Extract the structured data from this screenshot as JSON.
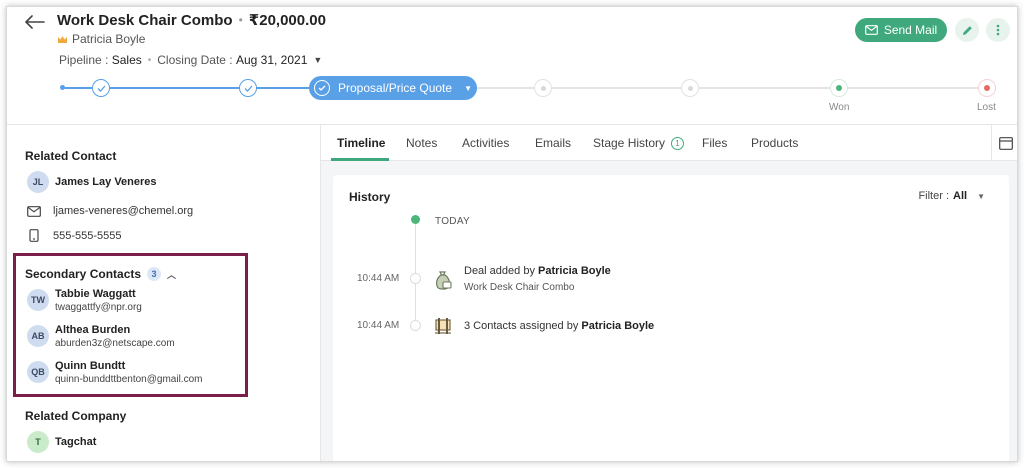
{
  "header": {
    "deal_name": "Work Desk Chair Combo",
    "amount": "₹20,000.00",
    "owner": "Patricia Boyle",
    "pipeline_label": "Pipeline :",
    "pipeline_value": "Sales",
    "closing_label": "Closing Date :",
    "closing_value": "Aug 31, 2021",
    "send_mail_label": "Send Mail"
  },
  "pipeline": {
    "current_stage": "Proposal/Price Quote",
    "won_label": "Won",
    "lost_label": "Lost"
  },
  "left": {
    "related_contact_title": "Related Contact",
    "primary_contact": {
      "initials": "JL",
      "name": "James Lay Veneres"
    },
    "email": "ljames-veneres@chemel.org",
    "phone": "555-555-5555",
    "secondary_title": "Secondary Contacts",
    "secondary_count": "3",
    "secondary_contacts": [
      {
        "initials": "TW",
        "name": "Tabbie Waggatt",
        "email": "twaggattfy@npr.org"
      },
      {
        "initials": "AB",
        "name": "Althea Burden",
        "email": "aburden3z@netscape.com"
      },
      {
        "initials": "QB",
        "name": "Quinn Bundtt",
        "email": "quinn-bunddttbenton@gmail.com"
      }
    ],
    "related_company_title": "Related Company",
    "company": {
      "initials": "T",
      "name": "Tagchat"
    }
  },
  "tabs": [
    {
      "label": "Timeline"
    },
    {
      "label": "Notes"
    },
    {
      "label": "Activities"
    },
    {
      "label": "Emails"
    },
    {
      "label": "Stage History",
      "badge": "1"
    },
    {
      "label": "Files"
    },
    {
      "label": "Products"
    }
  ],
  "history": {
    "title": "History",
    "filter_label": "Filter :",
    "filter_value": "All",
    "today_label": "TODAY",
    "events": [
      {
        "time": "10:44 AM",
        "text": "Deal added by",
        "actor": "Patricia Boyle",
        "sub": "Work Desk Chair Combo"
      },
      {
        "time": "10:44 AM",
        "text": "3 Contacts assigned by",
        "actor": "Patricia Boyle",
        "sub": ""
      }
    ]
  },
  "colors": {
    "accent_green": "#3fa87c",
    "pipeline_blue": "#5aa0e6",
    "highlight_border": "#7a1f49"
  }
}
